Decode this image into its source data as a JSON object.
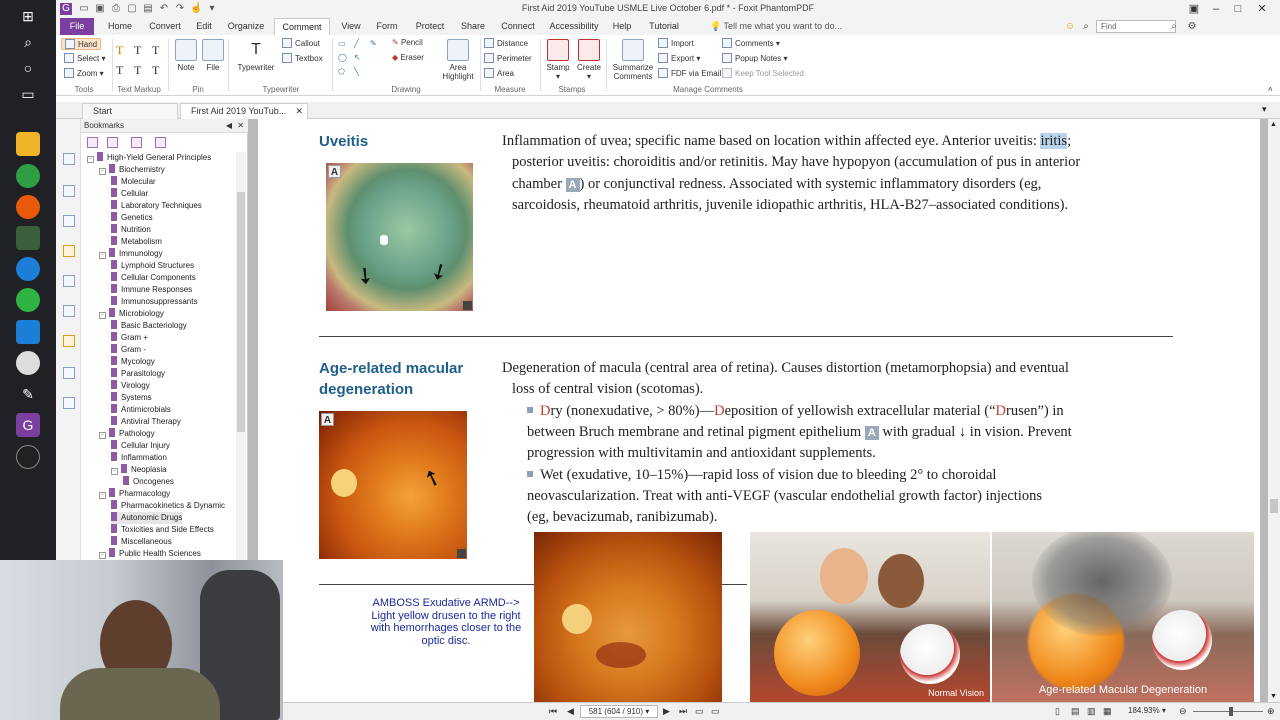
{
  "window": {
    "title": "First Aid 2019 YouTube USMLE Live October 6.pdf * - Foxit PhantomPDF"
  },
  "menu": {
    "tabs": [
      "File",
      "Home",
      "Convert",
      "Edit",
      "Organize",
      "Comment",
      "View",
      "Form",
      "Protect",
      "Share",
      "Connect",
      "Accessibility",
      "Help",
      "Tutorial"
    ],
    "active": "Comment",
    "tell_me": "Tell me what you want to do...",
    "find_placeholder": "Find"
  },
  "ribbon": {
    "tools": {
      "hand": "Hand",
      "select": "Select",
      "zoom": "Zoom",
      "label": "Tools"
    },
    "text_markup": {
      "label": "Text Markup"
    },
    "pin": {
      "note": "Note",
      "file": "File",
      "label": "Pin"
    },
    "typewriter": {
      "typewriter": "Typewriter",
      "callout": "Callout",
      "textbox": "Textbox",
      "label": "Typewriter"
    },
    "drawing": {
      "pencil": "Pencil",
      "eraser": "Eraser",
      "area_highlight": "Area Highlight",
      "label": "Drawing"
    },
    "measure": {
      "distance": "Distance",
      "perimeter": "Perimeter",
      "area": "Area",
      "label": "Measure"
    },
    "stamps": {
      "stamp": "Stamp",
      "create": "Create",
      "label": "Stamps"
    },
    "manage": {
      "summarize": "Summarize Comments",
      "import": "Import",
      "export": "Export",
      "fdf": "FDF via Email",
      "comments": "Comments",
      "popup_notes": "Popup Notes",
      "keep_tool": "Keep Tool Selected",
      "label": "Manage Comments"
    }
  },
  "doc_tabs": [
    "Start",
    "First Aid 2019 YouTub..."
  ],
  "bookmarks": {
    "title": "Bookmarks",
    "items": [
      {
        "label": "High-Yield General Principles",
        "level": 0,
        "expand": "-"
      },
      {
        "label": "Biochemistry",
        "level": 1,
        "expand": "-"
      },
      {
        "label": "Molecular",
        "level": 2,
        "expand": ""
      },
      {
        "label": "Cellular",
        "level": 2,
        "expand": ""
      },
      {
        "label": "Laboratory Techniques",
        "level": 2,
        "expand": ""
      },
      {
        "label": "Genetics",
        "level": 2,
        "expand": ""
      },
      {
        "label": "Nutrition",
        "level": 2,
        "expand": ""
      },
      {
        "label": "Metabolism",
        "level": 2,
        "expand": ""
      },
      {
        "label": "Immunology",
        "level": 1,
        "expand": "-"
      },
      {
        "label": "Lymphoid Structures",
        "level": 2,
        "expand": ""
      },
      {
        "label": "Cellular Components",
        "level": 2,
        "expand": ""
      },
      {
        "label": "Immune Responses",
        "level": 2,
        "expand": ""
      },
      {
        "label": "Immunosuppressants",
        "level": 2,
        "expand": ""
      },
      {
        "label": "Microbiology",
        "level": 1,
        "expand": "-"
      },
      {
        "label": "Basic Bacteriology",
        "level": 2,
        "expand": ""
      },
      {
        "label": "Gram +",
        "level": 2,
        "expand": ""
      },
      {
        "label": "Gram -",
        "level": 2,
        "expand": ""
      },
      {
        "label": "Mycology",
        "level": 2,
        "expand": ""
      },
      {
        "label": "Parasitology",
        "level": 2,
        "expand": ""
      },
      {
        "label": "Virology",
        "level": 2,
        "expand": ""
      },
      {
        "label": "Systems",
        "level": 2,
        "expand": ""
      },
      {
        "label": "Antimicrobials",
        "level": 2,
        "expand": ""
      },
      {
        "label": "Antiviral Therapy",
        "level": 2,
        "expand": ""
      },
      {
        "label": "Pathology",
        "level": 1,
        "expand": "-"
      },
      {
        "label": "Cellular Injury",
        "level": 2,
        "expand": ""
      },
      {
        "label": "Inflammation",
        "level": 2,
        "expand": ""
      },
      {
        "label": "Neoplasia",
        "level": 2,
        "expand": "-"
      },
      {
        "label": "Oncogenes",
        "level": 3,
        "expand": ""
      },
      {
        "label": "Pharmacology",
        "level": 1,
        "expand": "-"
      },
      {
        "label": "Pharmacokinetics & Dynamic",
        "level": 2,
        "expand": ""
      },
      {
        "label": "Autonomic Drugs",
        "level": 2,
        "expand": "",
        "selected": true
      },
      {
        "label": "Toxicities and Side Effects",
        "level": 2,
        "expand": ""
      },
      {
        "label": "Miscellaneous",
        "level": 2,
        "expand": ""
      },
      {
        "label": "Public Health Sciences",
        "level": 1,
        "expand": "-"
      }
    ]
  },
  "page": {
    "uveitis": {
      "heading": "Uveitis",
      "l1_a": "Inflammation of uvea; specific name based on location within affected eye. Anterior uveitis: ",
      "l1_hl": "iritis",
      "l1_b": ";",
      "l2": "posterior uveitis: choroiditis and/or retinitis. May have hypopyon (accumulation of pus in anterior",
      "l3_a": "chamber ",
      "l3_b": ") or conjunctival redness. Associated with systemic inflammatory disorders (eg,",
      "l4": "sarcoidosis, rheumatoid arthritis, juvenile idiopathic arthritis, HLA-B27–associated conditions).",
      "tag": "A"
    },
    "amd": {
      "heading_1": "Age-related macular",
      "heading_2": "degeneration",
      "l1": "Degeneration of macula (central area of retina). Causes distortion (metamorphopsia) and eventual",
      "l2": "loss of central vision (scotomas).",
      "dry_d": "D",
      "dry_rest": "ry (nonexudative, > 80%)—",
      "dry_d2": "D",
      "dry_rest2": "eposition of yellowish extracellular material (“",
      "dry_d3": "D",
      "dry_rest3": "rusen”) in",
      "dry_l2_a": "between Bruch membrane and retinal pigment epithelium ",
      "dry_l2_b": " with gradual ↓ in vision. Prevent",
      "dry_l3": "progression with multivitamin and antioxidant supplements.",
      "wet_l1": "Wet (exudative, 10–15%)—rapid loss of vision due to bleeding 2° to choroidal",
      "wet_l2": "neovascularization. Treat with anti-VEGF (vascular endothelial growth factor) injections",
      "wet_l3": "(eg, bevacizumab, ranibizumab).",
      "tag": "A"
    },
    "note": {
      "l1": "AMBOSS Exudative ARMD-->",
      "l2": "Light yellow drusen to the right",
      "l3": "with hemorrhages closer to the",
      "l4": "optic disc."
    },
    "caption_normal": "Normal Vision",
    "caption_amd": "Age-related Macular Degeneration"
  },
  "status": {
    "page_display": "581 (604 / 910)",
    "zoom": "184.93%"
  },
  "colors": {
    "brand": "#7b3fa0",
    "heading": "#1f5f8b",
    "dry_red": "#c0392b",
    "note_blue": "#1a2a9c"
  }
}
